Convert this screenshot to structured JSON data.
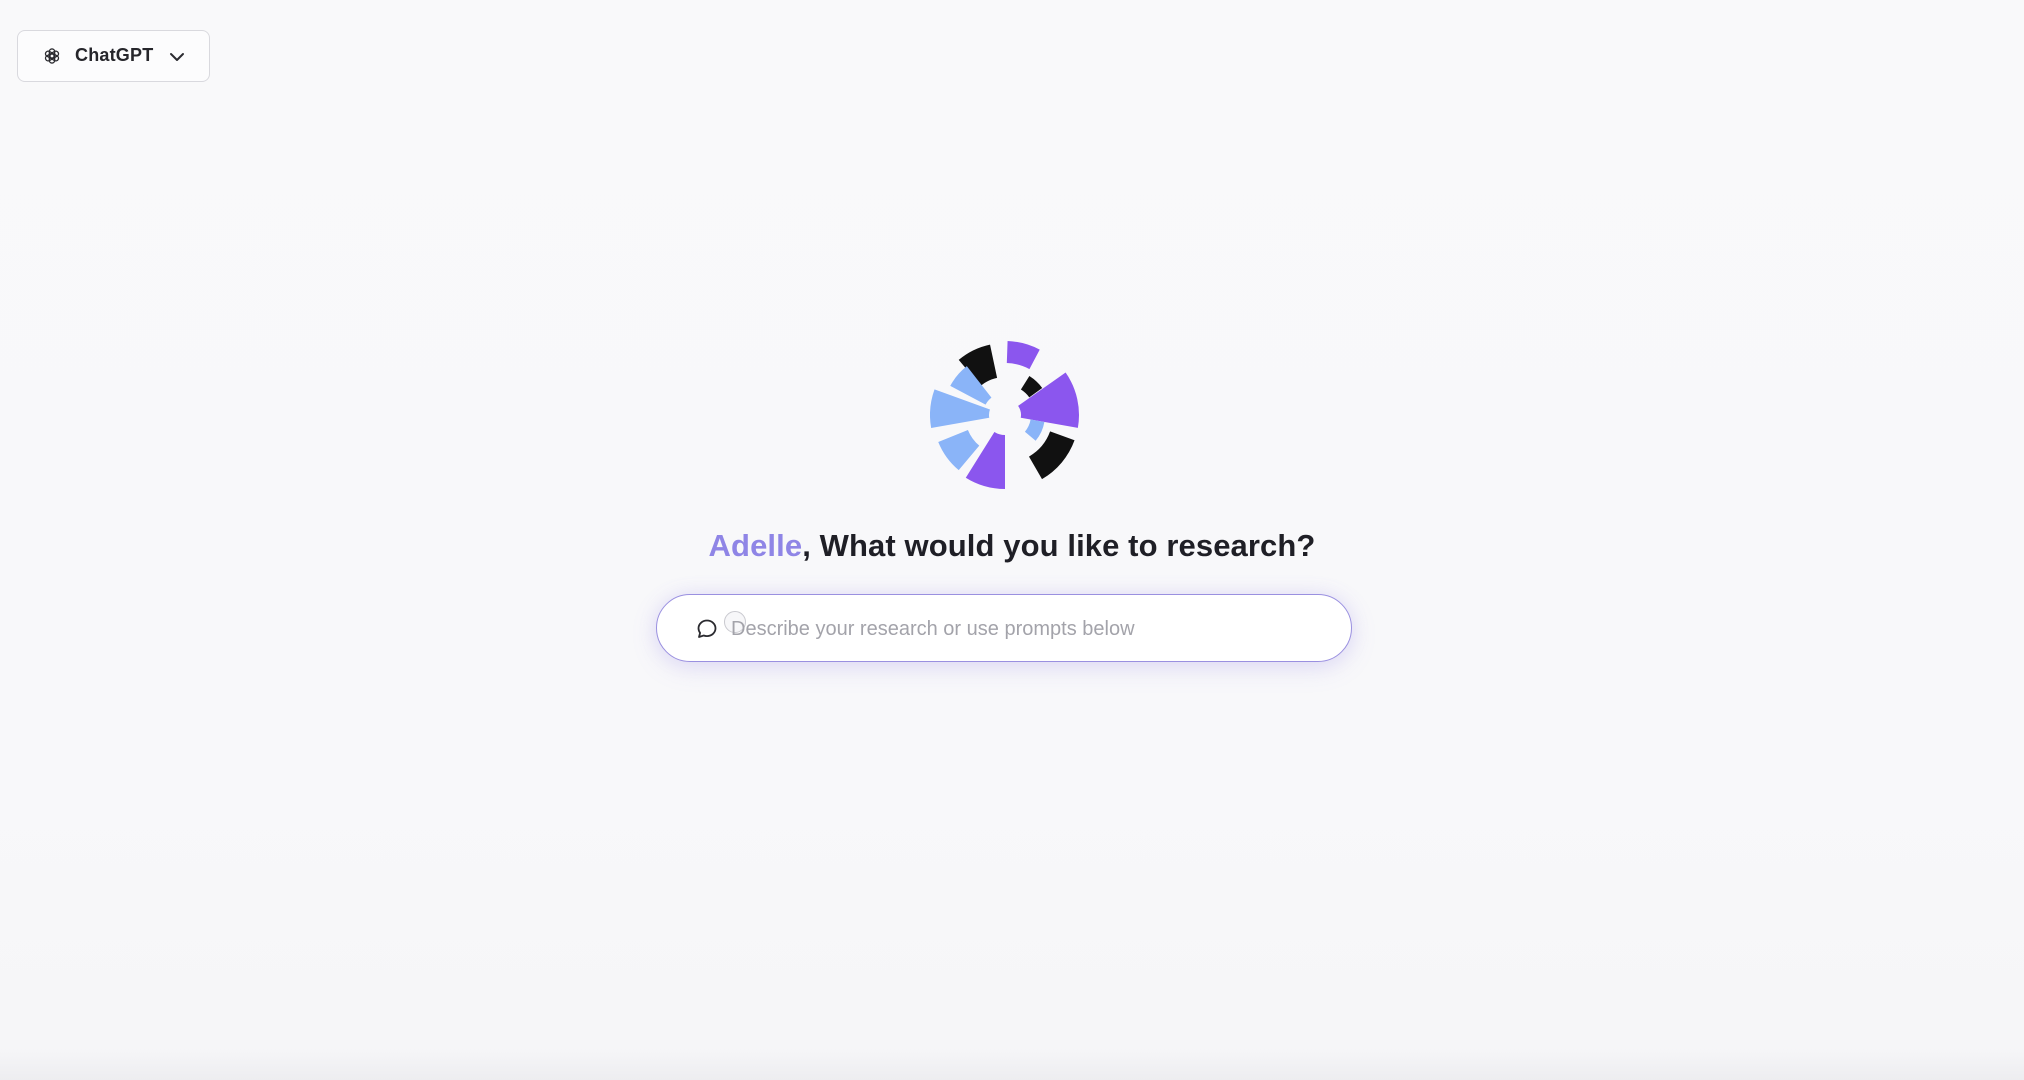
{
  "header": {
    "model_selector": {
      "label": "ChatGPT",
      "icon": "openai-logo-icon"
    }
  },
  "main": {
    "logo_icon": "brand-pinwheel-logo",
    "greeting": {
      "name": "Adelle",
      "question": ", What would you like to research?"
    },
    "search": {
      "placeholder": "Describe your research or use prompts below",
      "value": "",
      "icon": "chat-bubble-icon"
    }
  },
  "colors": {
    "accent_name": "#8f85e6",
    "logo_purple": "#8b56ee",
    "logo_blue": "#8ab4f8",
    "logo_black": "#111111",
    "search_border": "#9a90e0"
  }
}
